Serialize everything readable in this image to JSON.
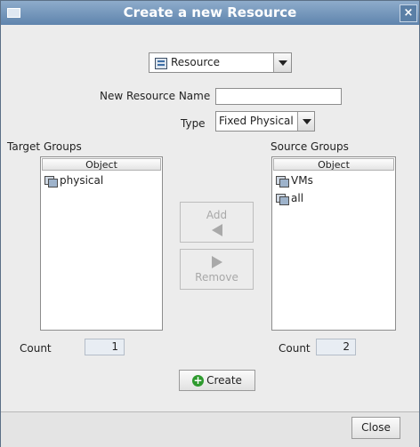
{
  "window": {
    "title": "Create a new Resource"
  },
  "resource_type": {
    "selected": "Resource"
  },
  "new_resource_name": {
    "label": "New Resource Name",
    "value": ""
  },
  "type": {
    "label": "Type",
    "selected": "Fixed Physical"
  },
  "target_groups": {
    "label": "Target Groups",
    "column_header": "Object",
    "items": [
      {
        "name": "physical"
      }
    ],
    "count_label": "Count",
    "count": "1"
  },
  "source_groups": {
    "label": "Source Groups",
    "column_header": "Object",
    "items": [
      {
        "name": "VMs"
      },
      {
        "name": "all"
      }
    ],
    "count_label": "Count",
    "count": "2"
  },
  "buttons": {
    "add": "Add",
    "remove": "Remove",
    "create": "Create",
    "close": "Close"
  },
  "icons": {
    "window": "window-menu-icon",
    "close": "close-icon",
    "resource": "resource-icon",
    "group": "group-icon",
    "add_arrow": "arrow-left-icon",
    "remove_arrow": "arrow-right-icon",
    "create": "plus-circle-icon"
  },
  "colors": {
    "titlebar": "#6f93b8",
    "create_icon": "#2e9a2e"
  }
}
